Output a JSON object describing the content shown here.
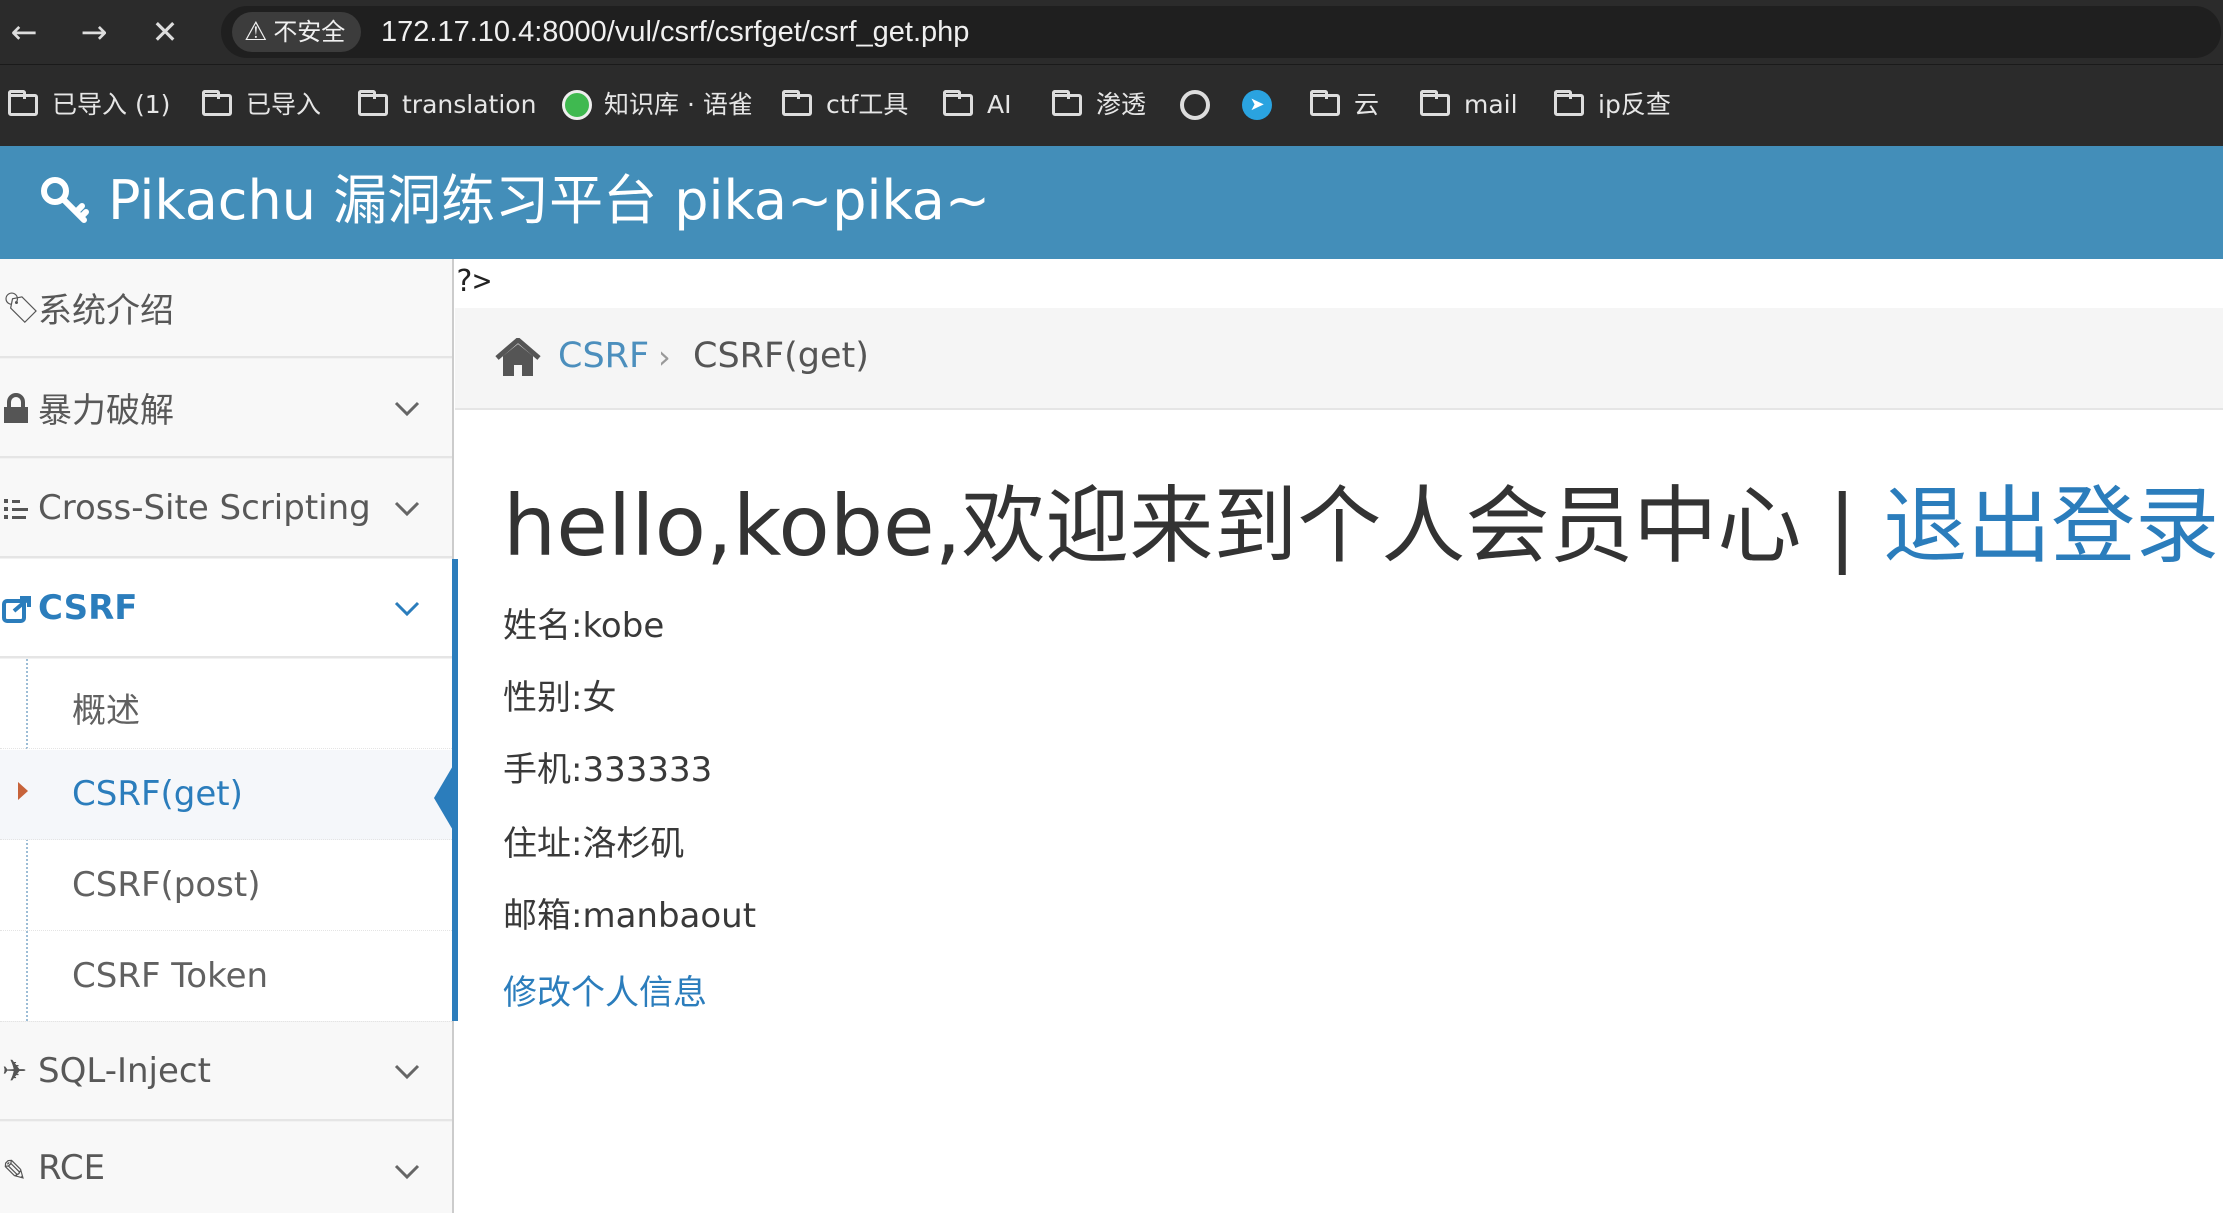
{
  "browser": {
    "security_label": "不安全",
    "url": "172.17.10.4:8000/vul/csrf/csrfget/csrf_get.php",
    "bookmarks": [
      {
        "label": "已导入 (1)",
        "icon": "folder-icon"
      },
      {
        "label": "已导入",
        "icon": "folder-icon"
      },
      {
        "label": "translation",
        "icon": "folder-icon"
      },
      {
        "label": "知识库 · 语雀",
        "icon": "yuque-icon"
      },
      {
        "label": "ctf工具",
        "icon": "folder-icon"
      },
      {
        "label": "AI",
        "icon": "folder-icon"
      },
      {
        "label": "渗透",
        "icon": "folder-icon"
      },
      {
        "label": "",
        "icon": "globe-icon"
      },
      {
        "label": "",
        "icon": "telegram-icon"
      },
      {
        "label": "云",
        "icon": "folder-icon"
      },
      {
        "label": "mail",
        "icon": "folder-icon"
      },
      {
        "label": "ip反查",
        "icon": "folder-icon"
      }
    ]
  },
  "header": {
    "title": "Pikachu 漏洞练习平台 pika~pika~",
    "bg_color": "#438eb9"
  },
  "sidebar": {
    "items": [
      {
        "label": "系统介绍",
        "icon": "tags-icon"
      },
      {
        "label": "暴力破解",
        "icon": "lock-icon"
      },
      {
        "label": "Cross-Site Scripting",
        "icon": "list-icon"
      },
      {
        "label": "CSRF",
        "icon": "share-icon"
      },
      {
        "label": "SQL-Inject",
        "icon": "plane-icon"
      },
      {
        "label": "RCE",
        "icon": "pencil-icon"
      }
    ],
    "csrf_sub": [
      {
        "label": "概述"
      },
      {
        "label": "CSRF(get)"
      },
      {
        "label": "CSRF(post)"
      },
      {
        "label": "CSRF Token"
      }
    ]
  },
  "main": {
    "php_echo": "?>",
    "breadcrumb": {
      "section": "CSRF",
      "page": "CSRF(get)"
    },
    "greeting": "hello,kobe,欢迎来到个人会员中心 | ",
    "logout": "退出登录",
    "info": [
      "姓名:kobe",
      "性别:女",
      "手机:333333",
      "住址:洛杉矶",
      "邮箱:manbaout"
    ],
    "edit_link": "修改个人信息"
  }
}
